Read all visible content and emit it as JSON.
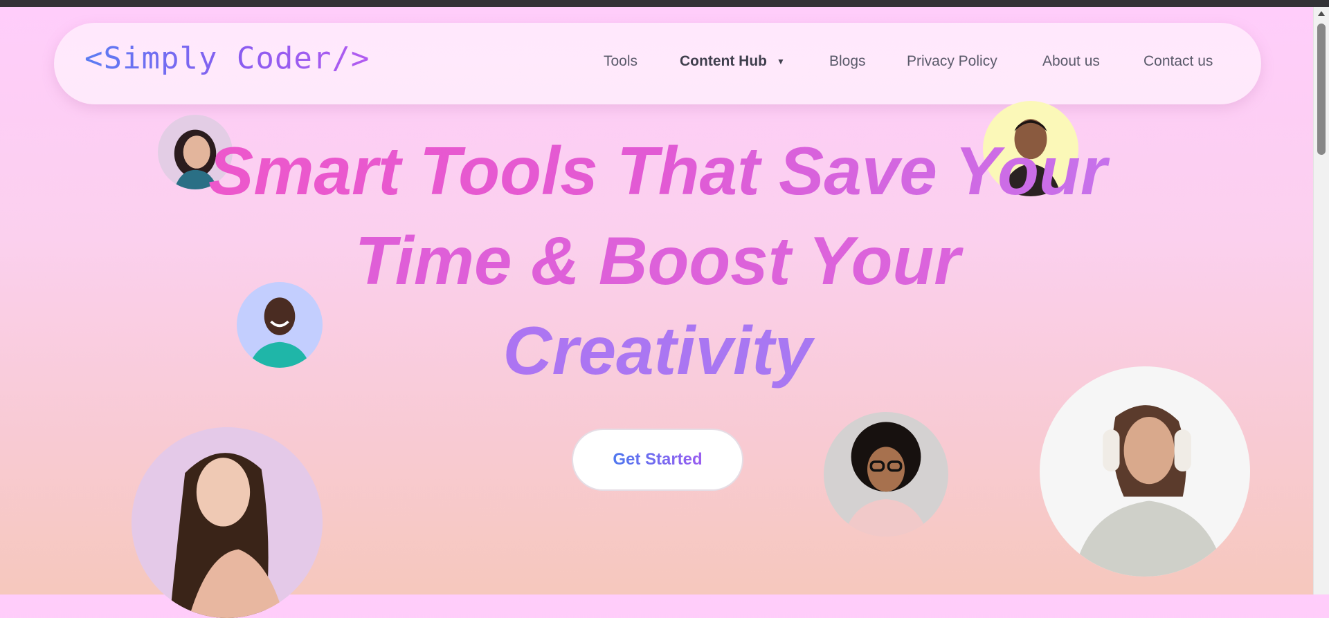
{
  "header": {
    "logo": "<Simply Coder/>",
    "nav": [
      {
        "label": "Tools"
      },
      {
        "label": "Content Hub",
        "has_dropdown": true
      },
      {
        "label": "Blogs"
      },
      {
        "label": "Privacy Policy"
      },
      {
        "label": "About us"
      },
      {
        "label": "Contact us"
      }
    ]
  },
  "hero": {
    "title_lines": [
      "Smart Tools That Save Your",
      "Time & Boost Your",
      "Creativity"
    ],
    "cta_label": "Get Started"
  },
  "avatars": [
    {
      "name": "woman-dark-hair-avatar",
      "bg": "#e3cde5"
    },
    {
      "name": "man-smiling-avatar",
      "bg": "#fbf8b8"
    },
    {
      "name": "man-teal-shirt-avatar",
      "bg": "#c3cefe"
    },
    {
      "name": "woman-long-hair-avatar",
      "bg": "#e4c9e8"
    },
    {
      "name": "woman-glasses-avatar",
      "bg": "#d4d1d1"
    },
    {
      "name": "woman-headphones-avatar",
      "bg": "#f6f6f6"
    }
  ],
  "colors": {
    "accent_pink": "#f256c7",
    "accent_purple": "#9f7df4",
    "logo_blue": "#5b7cf2"
  }
}
